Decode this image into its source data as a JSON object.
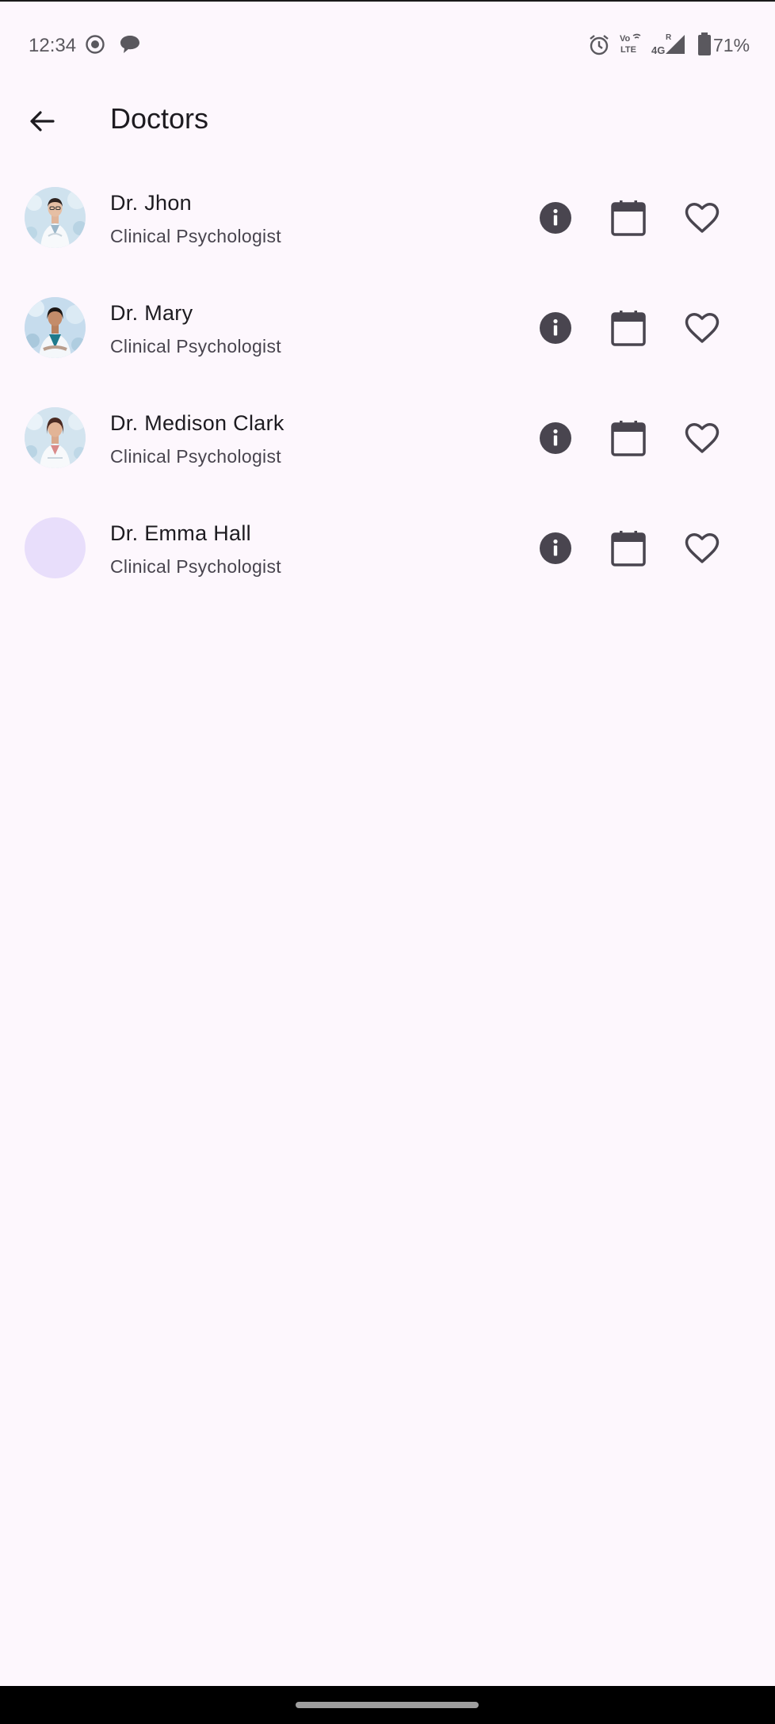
{
  "status_bar": {
    "time": "12:34",
    "battery": "71%",
    "icons": [
      "screen-record-icon",
      "chat-bubble-icon",
      "alarm-icon",
      "volte-icon",
      "signal-4g-icon",
      "battery-icon"
    ]
  },
  "app_bar": {
    "title": "Doctors",
    "back_icon": "arrow-back-icon"
  },
  "doctors": [
    {
      "name": "Dr. Jhon",
      "specialty": "Clinical Psychologist",
      "has_photo": true
    },
    {
      "name": "Dr. Mary",
      "specialty": "Clinical Psychologist",
      "has_photo": true
    },
    {
      "name": "Dr. Medison Clark",
      "specialty": "Clinical Psychologist",
      "has_photo": true
    },
    {
      "name": "Dr. Emma Hall",
      "specialty": "Clinical Psychologist",
      "has_photo": false
    }
  ],
  "row_actions": [
    "info-icon",
    "calendar-icon",
    "heart-outline-icon"
  ],
  "colors": {
    "background": "#fdf7fd",
    "icon": "#49454f",
    "avatar_placeholder": "#e8defb"
  }
}
